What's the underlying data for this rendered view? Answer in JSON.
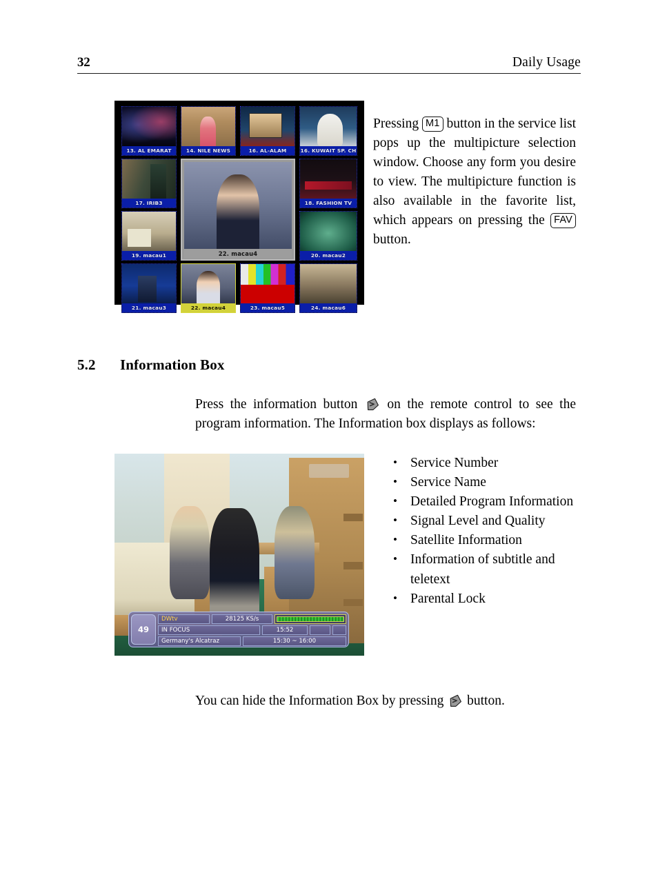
{
  "header": {
    "page_number": "32",
    "running_head": "Daily Usage"
  },
  "multipicture": {
    "paragraph_part1": "Pressing",
    "key_m1": "M1",
    "paragraph_part2": "button in the service list pops up the multipicture selection window. Choose any form you desire to view. The multipicture function is also available in the favorite list, which appears on pressing the",
    "key_fav": "FAV",
    "paragraph_part3": "button.",
    "screenshot": {
      "main_preview_label": "22. macau4",
      "cells": [
        {
          "label": "13. AL EMARAT"
        },
        {
          "label": "14. NILE NEWS"
        },
        {
          "label": "16. AL-ALAM"
        },
        {
          "label": "16. KUWAIT SP. CH"
        },
        {
          "label": "17. IRIB3"
        },
        {
          "label": "18. FASHION TV"
        },
        {
          "label": "19. macau1"
        },
        {
          "label": "20. macau2"
        },
        {
          "label": "21. macau3"
        },
        {
          "label": "22. macau4"
        },
        {
          "label": "23. macau5"
        },
        {
          "label": "24. macau6"
        }
      ]
    }
  },
  "section": {
    "number": "5.2",
    "title": "Information Box",
    "intro_part1": "Press the information button",
    "intro_part2": "on the remote control to see the program information. The Information box displays as follows:",
    "features": [
      "Service Number",
      "Service Name",
      "Detailed Program Information",
      "Signal Level and Quality",
      "Satellite Information",
      "Information of subtitle and teletext",
      "Parental Lock"
    ],
    "closing_part1": "You can hide the Information Box by pressing",
    "closing_part2": "button."
  },
  "infobox_screenshot": {
    "channel_number": "49",
    "service_name": "DWtv",
    "symbol_rate": "28125 KS/s",
    "program_title": "IN FOCUS",
    "clock": "15:52",
    "program_description": "Germany's Alcatraz",
    "program_time": "15:30 ~ 16:00"
  },
  "colors": {
    "label_blue": "#0a1ea8",
    "selected_yellow": "#d2d23a",
    "service_name_yellow": "#ffd34d",
    "signal_green": "#35c235",
    "overlay_purple": "#6d6898"
  }
}
